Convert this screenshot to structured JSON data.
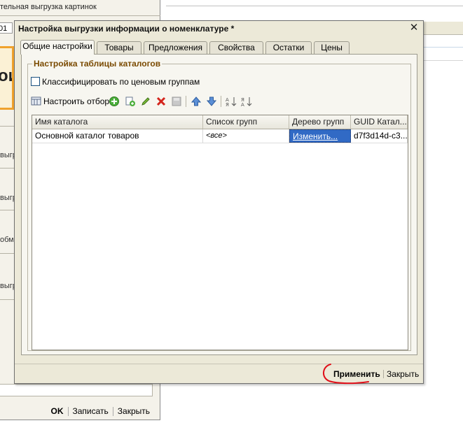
{
  "background_window": {
    "title": "тельная выгрузка картинок",
    "field_value": "01",
    "banner_text": "ои",
    "items": [
      "выгр",
      "выгр",
      "обм",
      "выгр"
    ],
    "buttons": {
      "ok": "OK",
      "save": "Записать",
      "close": "Закрыть"
    }
  },
  "dialog": {
    "title": "Настройка выгрузки информации о номенклатуре *",
    "close_glyph": "✕",
    "tabs": [
      {
        "label": "Общие настройки",
        "active": true
      },
      {
        "label": "Товары"
      },
      {
        "label": "Предложения"
      },
      {
        "label": "Свойства"
      },
      {
        "label": "Остатки"
      },
      {
        "label": "Цены"
      }
    ],
    "group_title": "Настройка таблицы каталогов",
    "checkbox_label": "Классифицировать по ценовым группам",
    "toolbar": {
      "filter_label": "Настроить отбор",
      "icons": [
        "filter-settings-icon",
        "add-icon",
        "copy-icon",
        "edit-icon",
        "delete-icon",
        "save-icon",
        "move-up-icon",
        "move-down-icon",
        "sort-asc-icon",
        "sort-desc-icon"
      ]
    },
    "table": {
      "columns": [
        "Имя каталога",
        "Список групп",
        "Дерево групп",
        "GUID Катал..."
      ],
      "rows": [
        {
          "name": "Основной каталог товаров",
          "groups": "<все>",
          "tree": "Изменить...",
          "guid": "d7f3d14d-c3..."
        }
      ]
    },
    "buttons": {
      "apply": "Применить",
      "close": "Закрыть"
    }
  },
  "colors": {
    "window_bg": "#ece9d8",
    "group_caption": "#7a4a00",
    "selection": "#316ac5",
    "annotation": "#e0101a",
    "banner_border": "#f0a22d"
  }
}
